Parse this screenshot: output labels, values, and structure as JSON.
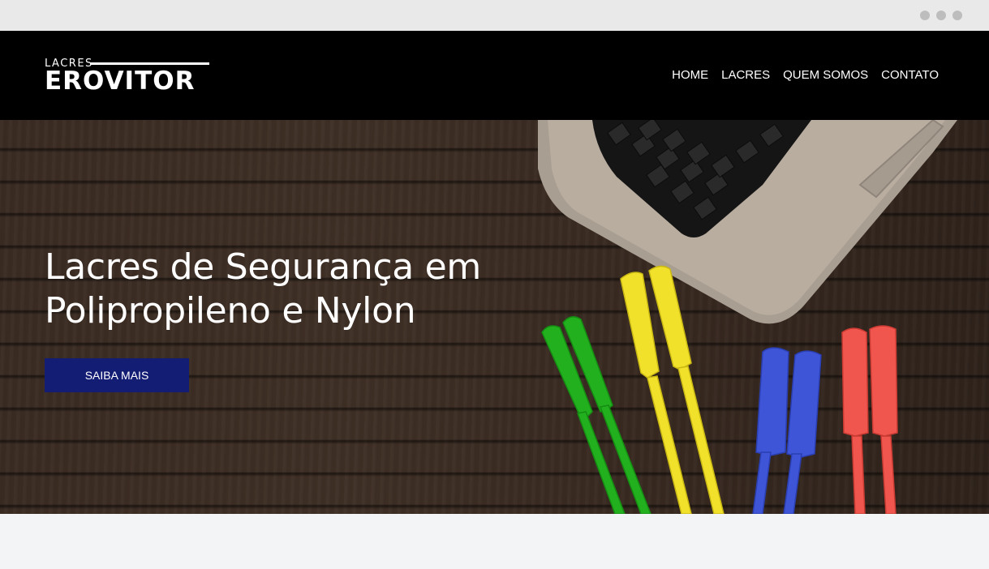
{
  "browser": {
    "icons": [
      "dot-icon",
      "dot-icon",
      "dot-icon"
    ]
  },
  "header": {
    "logo_top": "LACRES",
    "logo_main": "EROVITOR",
    "nav": [
      {
        "label": "HOME"
      },
      {
        "label": "LACRES"
      },
      {
        "label": "QUEM SOMOS"
      },
      {
        "label": "CONTATO"
      }
    ]
  },
  "hero": {
    "title_line1": "Lacres de Segurança em",
    "title_line2": "Polipropileno e Nylon",
    "cta_label": "SAIBA MAIS",
    "image": "laptop-keyboard-and-colored-security-seals",
    "seal_colors": [
      "#22b01e",
      "#f2e12a",
      "#3d55d6",
      "#f0564d"
    ]
  },
  "colors": {
    "header_bg": "#000000",
    "cta_bg": "#141d74",
    "page_bg": "#f2f4f6"
  }
}
